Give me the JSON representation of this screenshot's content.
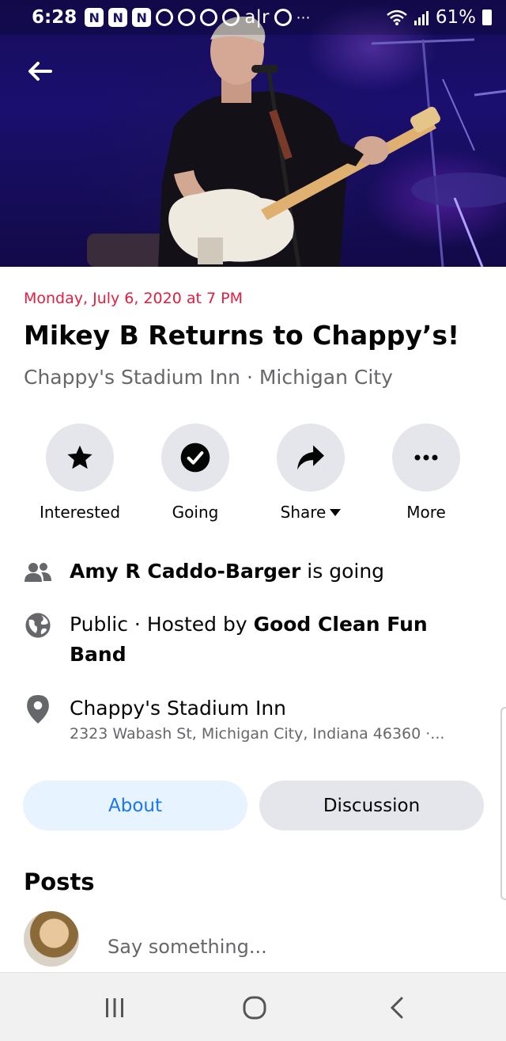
{
  "status_bar": {
    "time": "6:28",
    "app_icons": [
      "N",
      "N",
      "N"
    ],
    "extra": "a|r",
    "battery": "61%"
  },
  "event": {
    "date": "Monday, July 6, 2020 at 7 PM",
    "title": "Mikey B Returns to Chappy’s!",
    "subtitle": "Chappy's Stadium Inn · Michigan City"
  },
  "actions": [
    {
      "label": "Interested",
      "icon": "star-icon"
    },
    {
      "label": "Going",
      "icon": "check-circle-icon"
    },
    {
      "label": "Share",
      "icon": "share-arrow-icon"
    },
    {
      "label": "More",
      "icon": "more-dots-icon"
    }
  ],
  "info": {
    "going_name": "Amy R Caddo-Barger",
    "going_suffix": " is going",
    "privacy_prefix": "Public · Hosted by ",
    "host": "Good Clean Fun Band",
    "venue": "Chappy's Stadium Inn",
    "address": "2323 Wabash St, Michigan City, Indiana 46360 ·..."
  },
  "tabs": {
    "about": "About",
    "discussion": "Discussion"
  },
  "posts": {
    "title": "Posts",
    "composer_placeholder": "Say something..."
  },
  "colors": {
    "date_red": "#e41e3f",
    "link_blue": "#1877f2",
    "button_gray": "#e4e6eb",
    "tab_blue_bg": "#e7f3ff"
  }
}
